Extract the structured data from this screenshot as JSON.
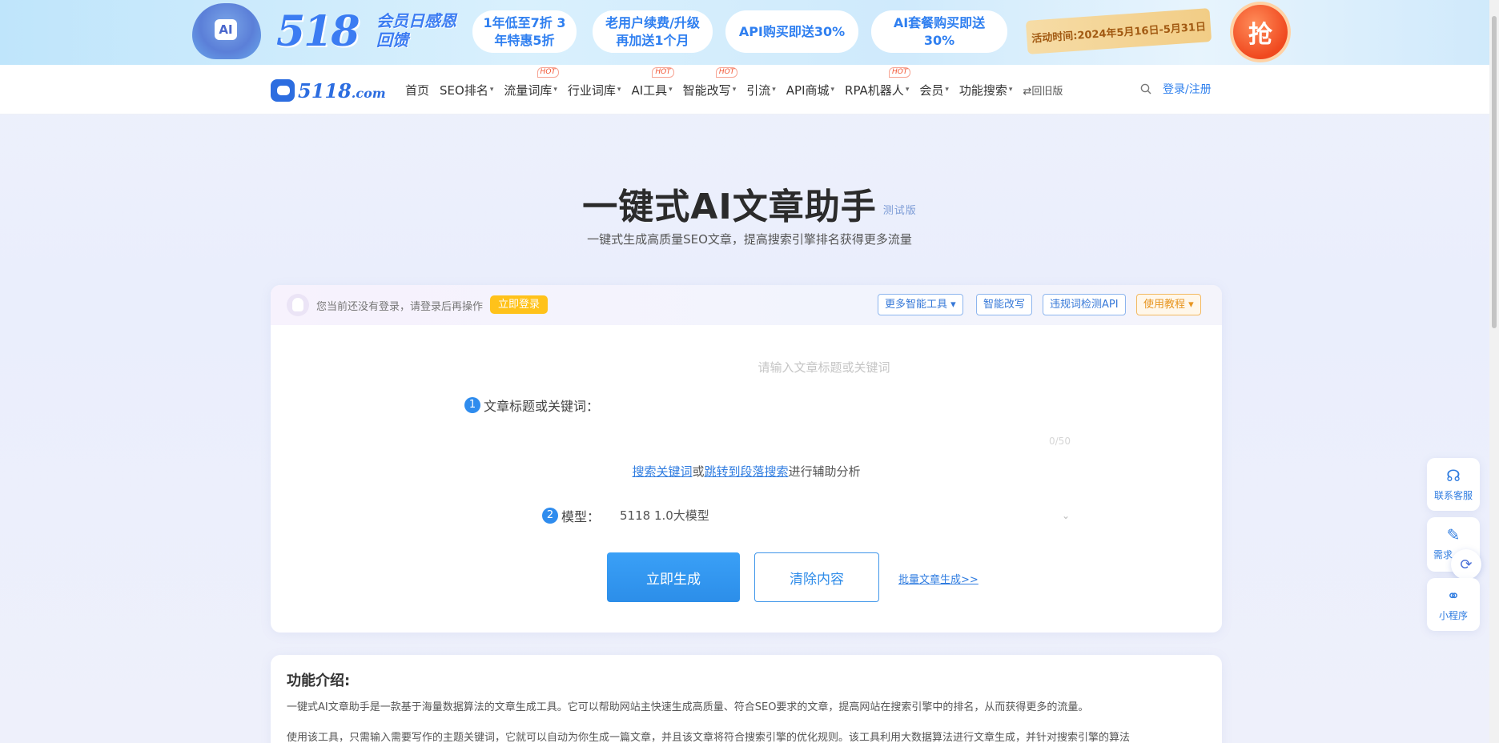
{
  "promo": {
    "mascot_text": "AI",
    "logo_number": "518",
    "logo_sub": "会员日感恩回馈",
    "pills": [
      "1年低至7折 3年特惠5折",
      "老用户续费/升级 再加送1个月",
      "API购买即送30%",
      "AI套餐购买即送30%"
    ],
    "ribbon": "活动时间:2024年5月16日-5月31日",
    "grab_label": "抢"
  },
  "nav": {
    "brand_main": "5118",
    "brand_domain": ".com",
    "items": [
      {
        "label": "首页",
        "caret": "",
        "hot": ""
      },
      {
        "label": "SEO排名",
        "caret": "▾",
        "hot": ""
      },
      {
        "label": "流量词库",
        "caret": "▾",
        "hot": "HOT"
      },
      {
        "label": "行业词库",
        "caret": "▾",
        "hot": ""
      },
      {
        "label": "AI工具",
        "caret": "▾",
        "hot": "HOT"
      },
      {
        "label": "智能改写",
        "caret": "▾",
        "hot": "HOT"
      },
      {
        "label": "引流",
        "caret": "▾",
        "hot": ""
      },
      {
        "label": "API商城",
        "caret": "▾",
        "hot": ""
      },
      {
        "label": "RPA机器人",
        "caret": "▾",
        "hot": "HOT"
      },
      {
        "label": "会员",
        "caret": "▾",
        "hot": ""
      },
      {
        "label": "功能搜索",
        "caret": "▾",
        "hot": ""
      }
    ],
    "old_version": "⇄回旧版",
    "login": "登录/注册",
    "search_icon": "search-icon"
  },
  "hero": {
    "title": "一键式AI文章助手",
    "beta": "测试版",
    "subtitle": "一键式生成高质量SEO文章，提高搜索引擎排名获得更多流量"
  },
  "card": {
    "login_note": "您当前还没有登录，请登录后再操作",
    "login_button": "立即登录",
    "tools": {
      "more": "更多智能工具 ▾",
      "rewrite": "智能改写",
      "api": "违规词检测API",
      "tutorial": "使用教程 ▾"
    },
    "field1_num": "1",
    "field1_label": "文章标题或关键词：",
    "title_placeholder": "请输入文章标题或关键词",
    "title_value": "",
    "counter": "0/50",
    "helper_link1": "搜索关键词",
    "helper_or": "或",
    "helper_link2": "跳转到段落搜索",
    "helper_tail": "进行辅助分析",
    "field2_num": "2",
    "field2_label": "模型：",
    "model_value": "5118 1.0大模型",
    "generate": "立即生成",
    "clear": "清除内容",
    "batch": "批量文章生成>>"
  },
  "intro": {
    "heading": "功能介绍:",
    "p1": "一键式AI文章助手是一款基于海量数据算法的文章生成工具。它可以帮助网站主快速生成高质量、符合SEO要求的文章，提高网站在搜索引擎中的排名，从而获得更多的流量。",
    "p2": "使用该工具，只需输入需要写作的主题关键词，它就可以自动为你生成一篇文章，并且该文章将符合搜索引擎的优化规则。该工具利用大数据算法进行文章生成，并针对搜索引擎的算法"
  },
  "floating": {
    "service": "联系客服",
    "need": "需求",
    "mini": "小程序"
  },
  "colors": {
    "accent": "#2f8cee",
    "login_yellow": "#ffc21a",
    "hot_red": "#f25533"
  }
}
